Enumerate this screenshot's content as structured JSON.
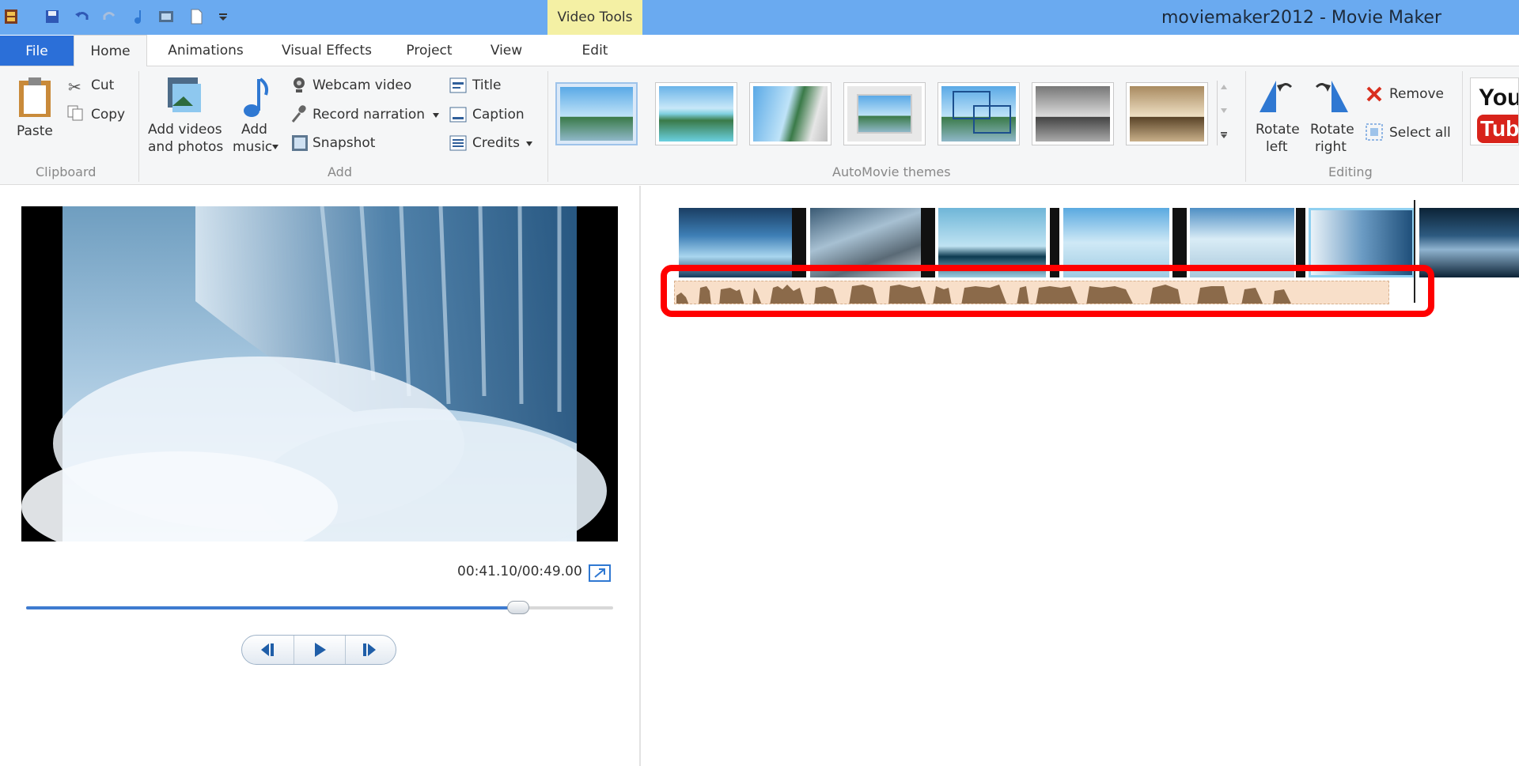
{
  "window": {
    "title": "moviemaker2012 - Movie Maker",
    "contextual_tab": "Video Tools"
  },
  "tabs": [
    {
      "label": "File"
    },
    {
      "label": "Home"
    },
    {
      "label": "Animations"
    },
    {
      "label": "Visual Effects"
    },
    {
      "label": "Project"
    },
    {
      "label": "View"
    },
    {
      "label": "Edit"
    }
  ],
  "ribbon": {
    "clipboard": {
      "paste": "Paste",
      "cut": "Cut",
      "copy": "Copy",
      "group": "Clipboard"
    },
    "add": {
      "add_videos_line1": "Add videos",
      "add_videos_line2": "and photos",
      "add_music_line1": "Add",
      "add_music_line2": "music",
      "webcam": "Webcam video",
      "narration": "Record narration",
      "snapshot": "Snapshot",
      "title": "Title",
      "caption": "Caption",
      "credits": "Credits",
      "group": "Add"
    },
    "themes": {
      "group": "AutoMovie themes"
    },
    "editing": {
      "rotate_left_1": "Rotate",
      "rotate_left_2": "left",
      "rotate_right_1": "Rotate",
      "rotate_right_2": "right",
      "remove": "Remove",
      "select_all": "Select all",
      "group": "Editing"
    },
    "share": {
      "youtube_top": "You",
      "youtube_bottom": "Tube"
    }
  },
  "preview": {
    "time": "00:41.10/00:49.00",
    "progress": 0.8388
  },
  "colors": {
    "accent": "#2b6fd8",
    "highlight": "#ff0000",
    "titlebar": "#6aaaf0",
    "audio": "#f8dfc9"
  }
}
